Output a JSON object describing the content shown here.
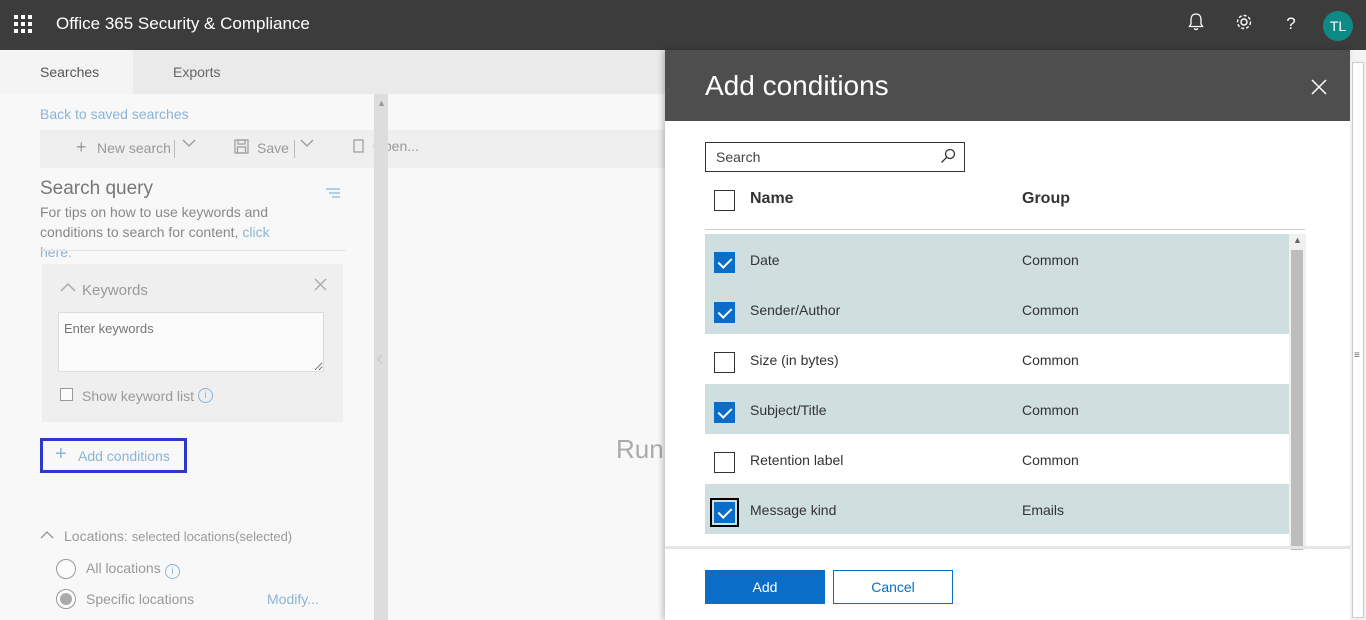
{
  "app": {
    "title": "Office 365 Security & Compliance",
    "avatar_initials": "TL",
    "icons": [
      "app-launcher-icon",
      "bell-icon",
      "gear-icon",
      "help-icon"
    ]
  },
  "tabs": [
    {
      "label": "Searches",
      "active": true
    },
    {
      "label": "Exports",
      "active": false
    }
  ],
  "left": {
    "back_link": "Back to saved searches",
    "toolbar": {
      "new_search": "New search",
      "save": "Save",
      "open": "Open..."
    },
    "search_query": {
      "title": "Search query",
      "tips_text": "For tips on how to use keywords and conditions to search for content,",
      "tips_link": "click here."
    },
    "keywords": {
      "title": "Keywords",
      "placeholder": "Enter keywords",
      "show_list_label": "Show keyword list"
    },
    "add_conditions_label": "Add conditions",
    "locations": {
      "title": "Locations:",
      "summary": "selected locations(selected)",
      "all_label": "All locations",
      "specific_label": "Specific locations",
      "modify_label": "Modify..."
    },
    "run_text": "Run"
  },
  "panel": {
    "title": "Add conditions",
    "search_placeholder": "Search",
    "columns": {
      "name": "Name",
      "group": "Group"
    },
    "rows": [
      {
        "name": "Date",
        "group": "Common",
        "checked": true
      },
      {
        "name": "Sender/Author",
        "group": "Common",
        "checked": true
      },
      {
        "name": "Size (in bytes)",
        "group": "Common",
        "checked": false
      },
      {
        "name": "Subject/Title",
        "group": "Common",
        "checked": true
      },
      {
        "name": "Retention label",
        "group": "Common",
        "checked": false
      },
      {
        "name": "Message kind",
        "group": "Emails",
        "checked": true
      }
    ],
    "add_label": "Add",
    "cancel_label": "Cancel"
  },
  "colors": {
    "accent": "#0a6dc7",
    "topbar": "#3c3c3c",
    "panel_header": "#4e4e4e",
    "selected_row": "#cfdedf",
    "focus_outline": "#3038c8"
  }
}
